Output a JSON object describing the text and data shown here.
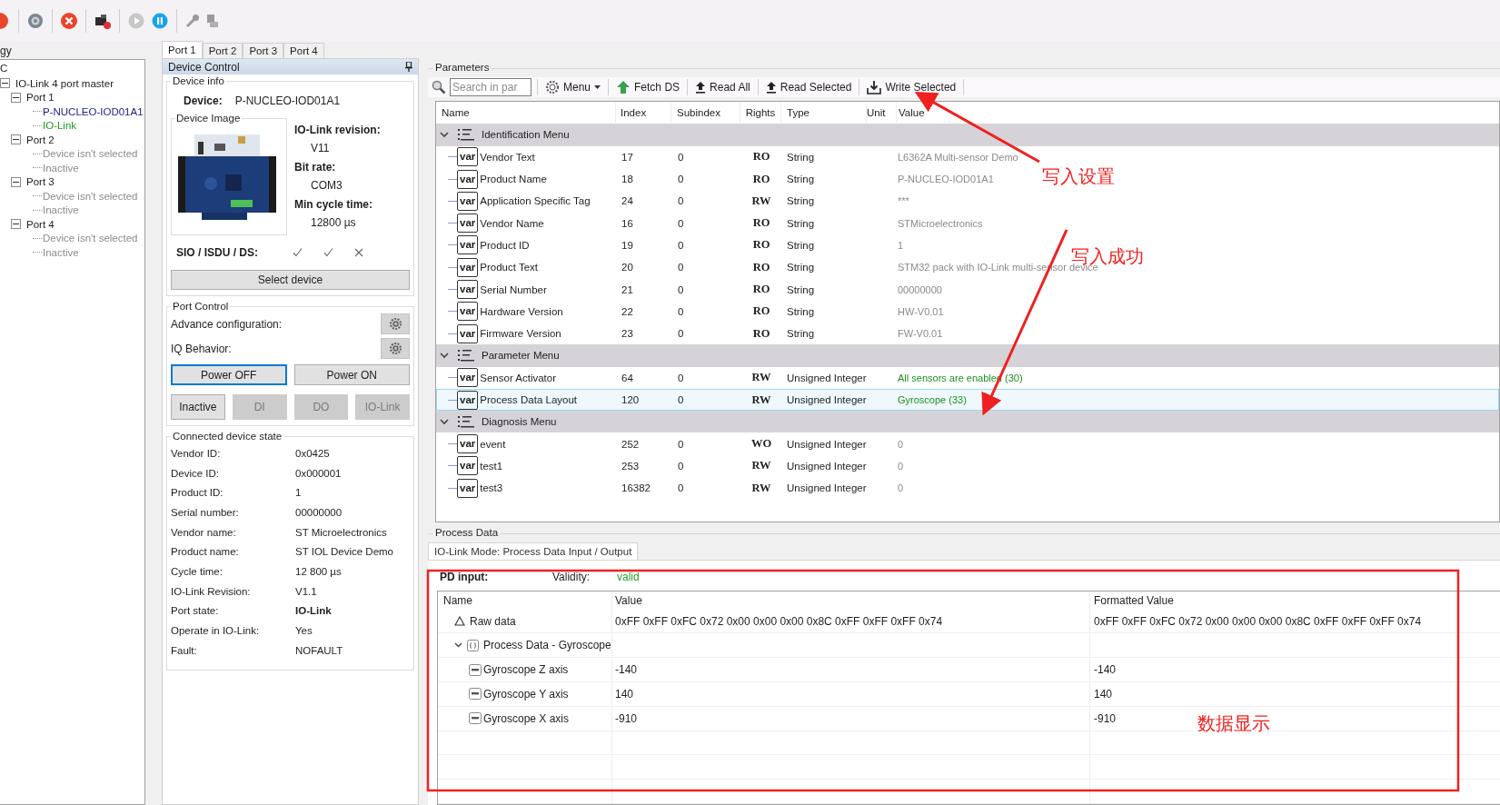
{
  "topology": {
    "title": "gy",
    "root": "C",
    "items": [
      {
        "label": "IO-Link 4 port master",
        "expanded": true,
        "children": [
          {
            "label": "Port 1",
            "expanded": true,
            "children": [
              {
                "label": "P-NUCLEO-IOD01A1",
                "kind": "device"
              },
              {
                "label": "IO-Link",
                "kind": "mode"
              }
            ]
          },
          {
            "label": "Port 2",
            "expanded": true,
            "children": [
              {
                "label": "Device isn't selected",
                "kind": "empty"
              },
              {
                "label": "Inactive",
                "kind": "empty"
              }
            ]
          },
          {
            "label": "Port 3",
            "expanded": true,
            "children": [
              {
                "label": "Device isn't selected",
                "kind": "empty"
              },
              {
                "label": "Inactive",
                "kind": "empty"
              }
            ]
          },
          {
            "label": "Port 4",
            "expanded": true,
            "children": [
              {
                "label": "Device isn't selected",
                "kind": "empty"
              },
              {
                "label": "Inactive",
                "kind": "empty"
              }
            ]
          }
        ]
      }
    ]
  },
  "port_tabs": [
    {
      "label": "Port 1",
      "selected": true
    },
    {
      "label": "Port 2",
      "selected": false
    },
    {
      "label": "Port 3",
      "selected": false
    },
    {
      "label": "Port 4",
      "selected": false
    }
  ],
  "device_control": {
    "title": "Device Control",
    "device_info": {
      "legend": "Device info",
      "device_label": "Device:",
      "device_value": "P-NUCLEO-IOD01A1",
      "image_legend": "Device Image",
      "details": [
        {
          "label": "IO-Link revision:",
          "value": "V11"
        },
        {
          "label": "Bit rate:",
          "value": "COM3"
        },
        {
          "label": "Min cycle time:",
          "value": "12800 µs"
        }
      ],
      "sio_label": "SIO / ISDU / DS:",
      "sio_flags": [
        {
          "supported": true
        },
        {
          "supported": true
        },
        {
          "supported": false
        }
      ],
      "select_button": "Select device"
    },
    "port_control": {
      "legend": "Port Control",
      "settings": [
        {
          "label": "Advance configuration:"
        },
        {
          "label": "IQ Behavior:"
        }
      ],
      "power_buttons": [
        {
          "label": "Power OFF",
          "selected": true
        },
        {
          "label": "Power ON",
          "selected": false
        }
      ],
      "mode_buttons": [
        {
          "label": "Inactive",
          "disabled": false
        },
        {
          "label": "DI",
          "disabled": true
        },
        {
          "label": "DO",
          "disabled": true
        },
        {
          "label": "IO-Link",
          "disabled": true
        }
      ]
    },
    "device_state": {
      "legend": "Connected device state",
      "rows": [
        {
          "label": "Vendor ID:",
          "value": "0x0425",
          "bold": false
        },
        {
          "label": "Device ID:",
          "value": "0x000001",
          "bold": false
        },
        {
          "label": "Product ID:",
          "value": "1",
          "bold": false
        },
        {
          "label": "Serial number:",
          "value": "00000000",
          "bold": false
        },
        {
          "label": "Vendor name:",
          "value": "ST Microelectronics",
          "bold": false
        },
        {
          "label": "Product name:",
          "value": "ST IOL Device Demo",
          "bold": false
        },
        {
          "label": "Cycle time:",
          "value": "12 800 µs",
          "bold": false
        },
        {
          "label": "IO-Link Revision:",
          "value": "V1.1",
          "bold": false
        },
        {
          "label": "Port state:",
          "value": "IO-Link",
          "bold": true
        },
        {
          "label": "Operate in IO-Link:",
          "value": "Yes",
          "bold": false
        },
        {
          "label": "Fault:",
          "value": "NOFAULT",
          "bold": false
        }
      ]
    }
  },
  "parameters": {
    "legend": "Parameters",
    "search": {
      "placeholder": "Search in par"
    },
    "actions": [
      {
        "label": "Menu",
        "kind": "menu"
      },
      {
        "label": "Fetch DS",
        "kind": "fetch"
      },
      {
        "label": "Read All",
        "kind": "read"
      },
      {
        "label": "Read Selected",
        "kind": "read"
      },
      {
        "label": "Write Selected",
        "kind": "write"
      }
    ],
    "columns": [
      "Name",
      "Index",
      "Subindex",
      "Rights",
      "Type",
      "Unit",
      "Value"
    ],
    "groups": [
      {
        "name": "Identification Menu",
        "expanded": true,
        "items": [
          {
            "icon_text": "var",
            "name": "Vendor Text",
            "index": "17",
            "subindex": "0",
            "rights": "RO",
            "type": "String",
            "value": "L6362A Multi-sensor Demo",
            "changed": false,
            "selected": false
          },
          {
            "icon_text": "var",
            "name": "Product Name",
            "index": "18",
            "subindex": "0",
            "rights": "RO",
            "type": "String",
            "value": "P-NUCLEO-IOD01A1",
            "changed": false,
            "selected": false
          },
          {
            "icon_text": "var",
            "name": "Application Specific Tag",
            "index": "24",
            "subindex": "0",
            "rights": "RW",
            "type": "String",
            "value": "***",
            "changed": false,
            "selected": false
          },
          {
            "icon_text": "var",
            "name": "Vendor Name",
            "index": "16",
            "subindex": "0",
            "rights": "RO",
            "type": "String",
            "value": "STMicroelectronics",
            "changed": false,
            "selected": false
          },
          {
            "icon_text": "var",
            "name": "Product ID",
            "index": "19",
            "subindex": "0",
            "rights": "RO",
            "type": "String",
            "value": "1",
            "changed": false,
            "selected": false
          },
          {
            "icon_text": "var",
            "name": "Product Text",
            "index": "20",
            "subindex": "0",
            "rights": "RO",
            "type": "String",
            "value": "STM32 pack with IO-Link multi-sensor device",
            "changed": false,
            "selected": false
          },
          {
            "icon_text": "var",
            "name": "Serial Number",
            "index": "21",
            "subindex": "0",
            "rights": "RO",
            "type": "String",
            "value": "00000000",
            "changed": false,
            "selected": false
          },
          {
            "icon_text": "var",
            "name": "Hardware Version",
            "index": "22",
            "subindex": "0",
            "rights": "RO",
            "type": "String",
            "value": "HW-V0.01",
            "changed": false,
            "selected": false
          },
          {
            "icon_text": "var",
            "name": "Firmware Version",
            "index": "23",
            "subindex": "0",
            "rights": "RO",
            "type": "String",
            "value": "FW-V0.01",
            "changed": false,
            "selected": false
          }
        ]
      },
      {
        "name": "Parameter Menu",
        "expanded": true,
        "items": [
          {
            "icon_text": "var",
            "name": "Sensor Activator",
            "index": "64",
            "subindex": "0",
            "rights": "RW",
            "type": "Unsigned Integer",
            "value": "All sensors are enabled (30)",
            "changed": true,
            "selected": false
          },
          {
            "icon_text": "var",
            "name": "Process Data Layout",
            "index": "120",
            "subindex": "0",
            "rights": "RW",
            "type": "Unsigned Integer",
            "value": "Gyroscope (33)",
            "changed": true,
            "selected": true
          }
        ]
      },
      {
        "name": "Diagnosis Menu",
        "expanded": true,
        "items": [
          {
            "icon_text": "var",
            "name": "event",
            "index": "252",
            "subindex": "0",
            "rights": "WO",
            "type": "Unsigned Integer",
            "value": "0",
            "changed": false,
            "selected": false
          },
          {
            "icon_text": "var",
            "name": "test1",
            "index": "253",
            "subindex": "0",
            "rights": "RW",
            "type": "Unsigned Integer",
            "value": "0",
            "changed": false,
            "selected": false
          },
          {
            "icon_text": "var",
            "name": "test3",
            "index": "16382",
            "subindex": "0",
            "rights": "RW",
            "type": "Unsigned Integer",
            "value": "0",
            "changed": false,
            "selected": false
          }
        ]
      }
    ]
  },
  "process_data": {
    "legend": "Process Data",
    "tab": "IO-Link Mode: Process Data Input / Output",
    "pd_input_label": "PD input:",
    "validity_label": "Validity:",
    "validity_value": "valid",
    "columns": [
      "Name",
      "Value",
      "Formatted Value"
    ],
    "rows": [
      {
        "kind": "raw",
        "name": "Raw data",
        "value": "0xFF 0xFF 0xFC 0x72 0x00 0x00 0x00 0x8C 0xFF 0xFF 0xFF 0x74",
        "formatted": "0xFF 0xFF 0xFC 0x72 0x00 0x00 0x00 0x8C 0xFF 0xFF 0xFF 0x74"
      },
      {
        "kind": "group",
        "name": "Process Data - Gyroscope",
        "expanded": true,
        "children": [
          {
            "name": "Gyroscope Z axis",
            "value": "-140",
            "formatted": "-140"
          },
          {
            "name": "Gyroscope Y axis",
            "value": "140",
            "formatted": "140"
          },
          {
            "name": "Gyroscope X axis",
            "value": "-910",
            "formatted": "-910"
          }
        ]
      }
    ]
  },
  "annotations": [
    {
      "text": "写入设置"
    },
    {
      "text": "写入成功"
    },
    {
      "text": "数据显示"
    }
  ]
}
